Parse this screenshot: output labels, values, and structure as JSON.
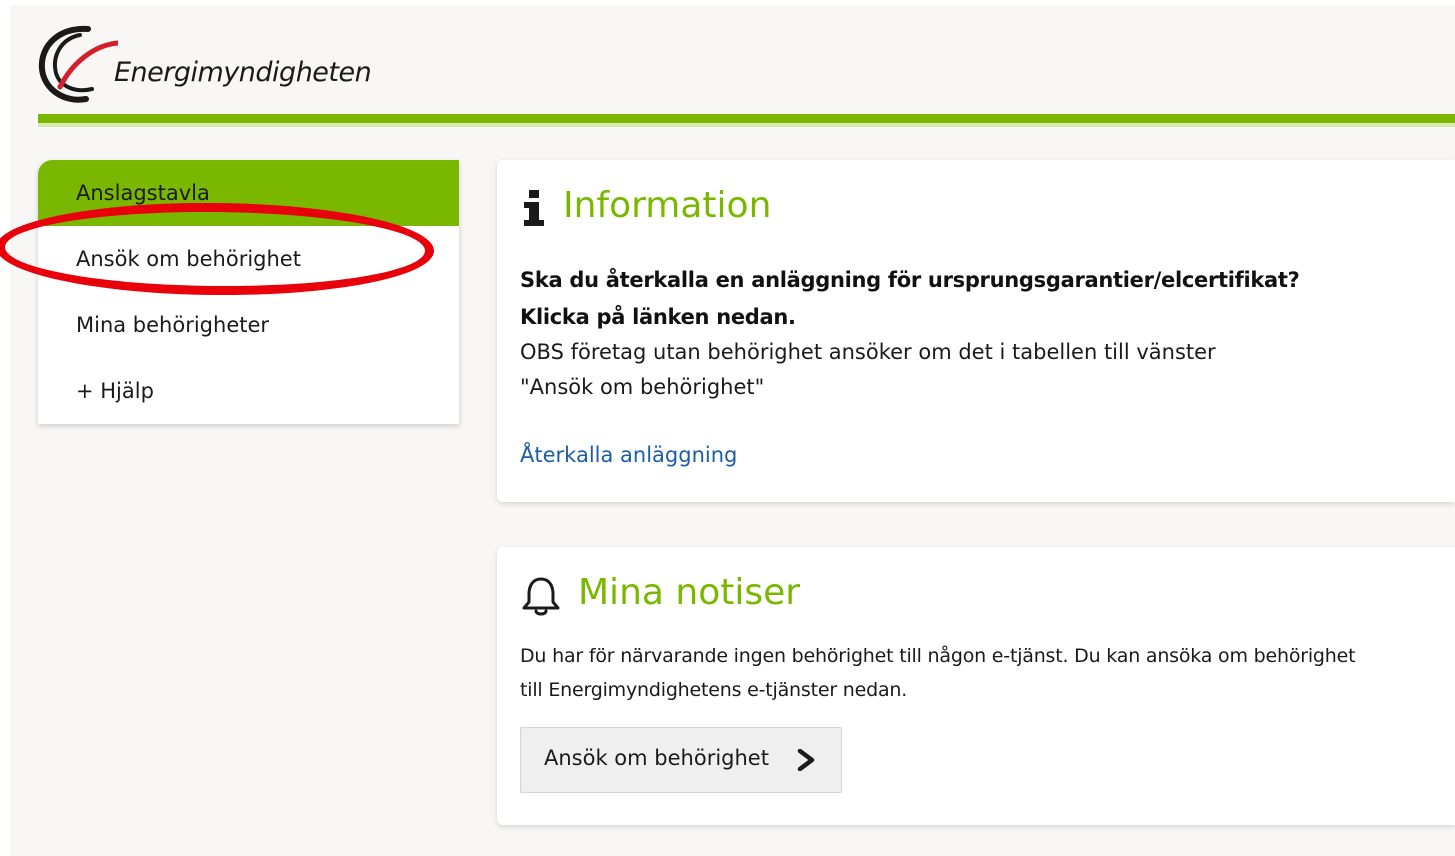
{
  "header": {
    "logo_text": "Energimyndigheten"
  },
  "sidebar": {
    "items": [
      {
        "label": "Anslagstavla",
        "active": true
      },
      {
        "label": "Ansök om behörighet",
        "active": false
      },
      {
        "label": "Mina behörigheter",
        "active": false
      },
      {
        "label": "+ Hjälp",
        "active": false
      }
    ]
  },
  "information": {
    "title": "Information",
    "icon": "info-icon",
    "question_line1": "Ska du återkalla en anläggning för ursprungsgarantier/elcertifikat?",
    "question_line2": "Klicka på länken nedan.",
    "note_line1": "OBS företag utan behörighet ansöker om det i tabellen till vänster",
    "note_line2": "\"Ansök om behörighet\"",
    "link_label": "Återkalla anläggning"
  },
  "notiser": {
    "title": "Mina notiser",
    "icon": "bell-icon",
    "text_line1": "Du har för närvarande ingen behörighet till någon e-tjänst. Du kan ansöka om behörighet",
    "text_line2": "till Energimyndighetens e-tjänster nedan.",
    "button_label": "Ansök om behörighet",
    "button_icon": "chevron-right-icon"
  },
  "colors": {
    "brand_green": "#7ab800",
    "link_blue": "#1c5da8",
    "annotation_red": "#e8000b"
  }
}
